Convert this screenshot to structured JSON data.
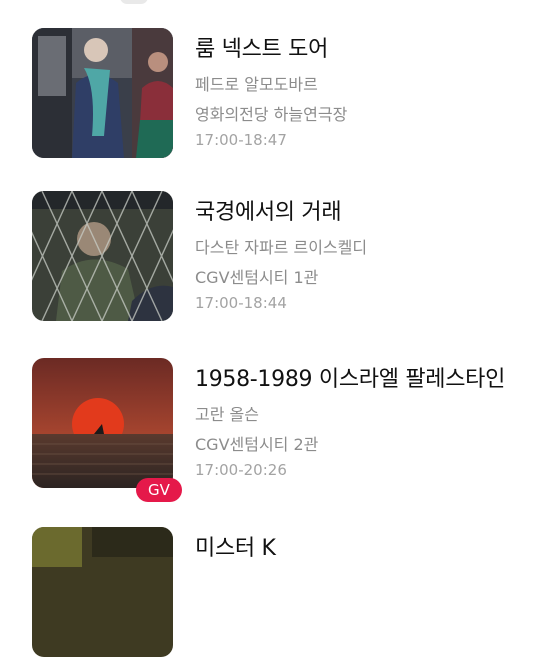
{
  "screenings": [
    {
      "title": "룸 넥스트 도어",
      "director": "페드로 알모도바르",
      "venue": "영화의전당 하늘연극장",
      "time": "17:00-18:47",
      "badge": ""
    },
    {
      "title": "국경에서의 거래",
      "director": "다스탄 자파르 르이스켈디",
      "venue": "CGV센텀시티 1관",
      "time": "17:00-18:44",
      "badge": ""
    },
    {
      "title": "1958-1989 이스라엘 팔레스타인",
      "director": "고란 올슨",
      "venue": "CGV센텀시티 2관",
      "time": "17:00-20:26",
      "badge": "GV"
    },
    {
      "title": "미스터 K",
      "director": "",
      "venue": "",
      "time": "",
      "badge": ""
    }
  ],
  "colors": {
    "title": "#111111",
    "meta": "#8c8c8c",
    "time": "#a3a3a3",
    "badge_bg": "#e5194a"
  }
}
